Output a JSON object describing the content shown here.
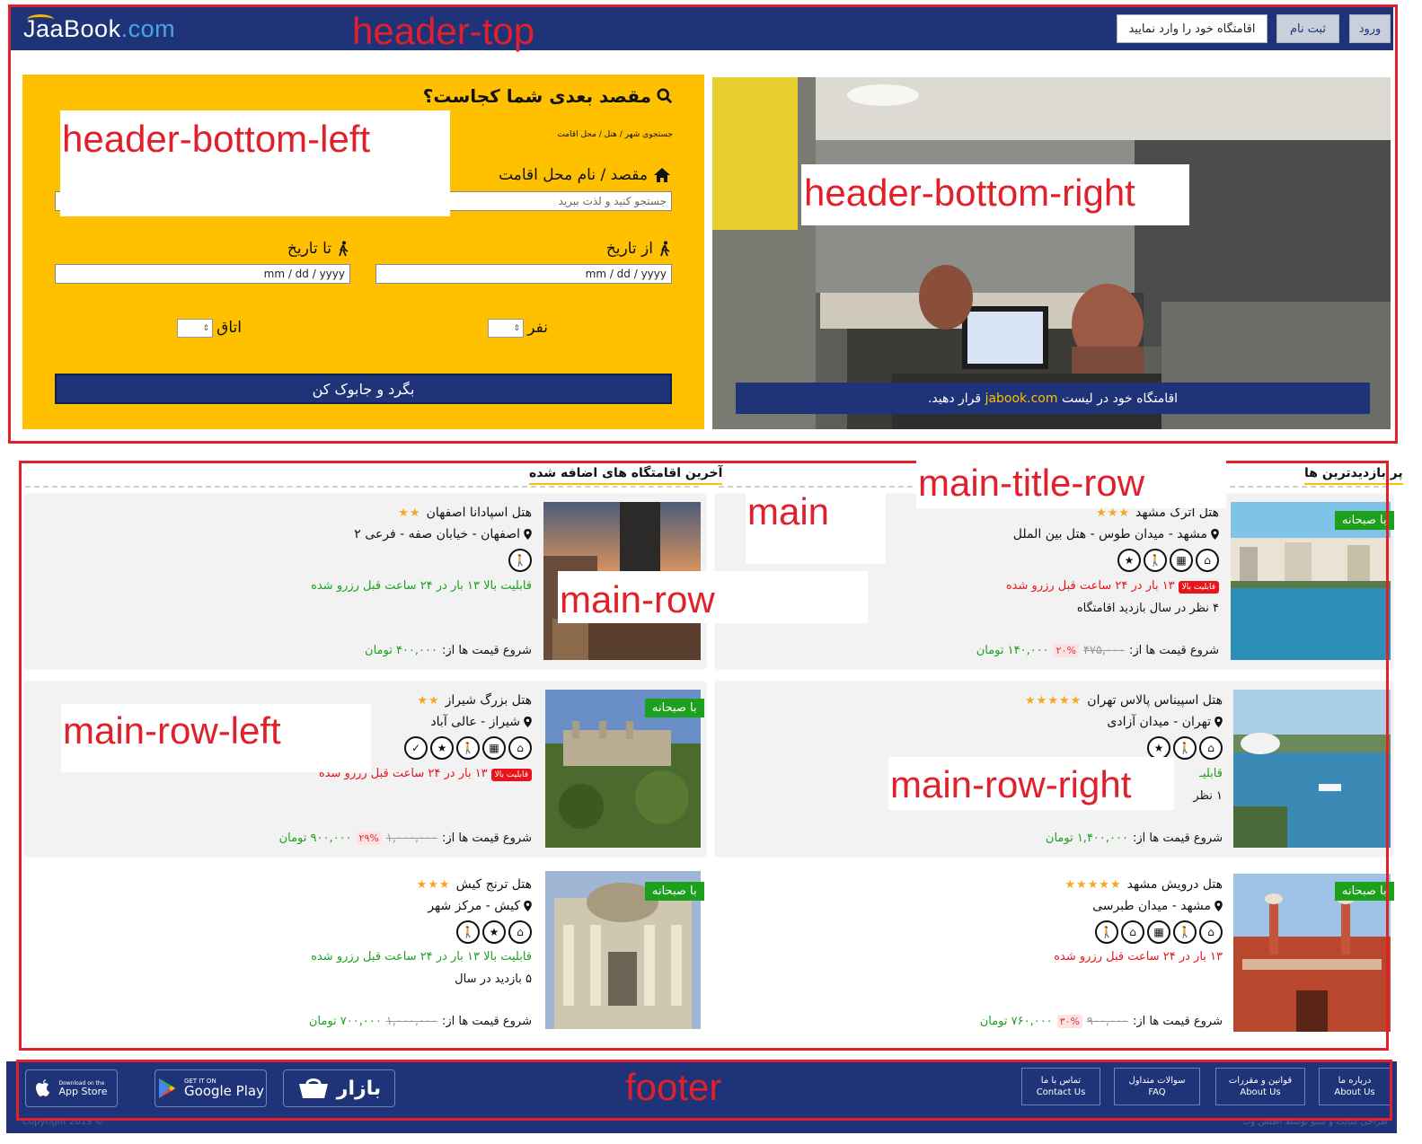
{
  "header": {
    "logo": {
      "main": "JaaBook",
      "suffix": ".com"
    },
    "buttons": {
      "login": "ورود",
      "register": "ثبت نام",
      "add_property": "اقامتگاه خود را وارد نمایید"
    }
  },
  "search": {
    "title": "مقصد بعدی شما کجاست؟",
    "breadcrumb": "جستجوی شهر / هتل / محل اقامت",
    "destination_label": "مقصد / نام محل اقامت",
    "destination_placeholder": "جستجو کنید و لذت ببرید",
    "from_label": "از تاریخ",
    "to_label": "تا تاریخ",
    "date_placeholder": "mm / dd / yyyy",
    "persons_label": "نفر",
    "rooms_label": "اتاق",
    "submit": "بگرد و جابوک کن"
  },
  "hero": {
    "caption_prefix": "اقامتگاه خود در لیست",
    "caption_link": "jabook.com",
    "caption_suffix": "قرار دهید."
  },
  "sections": {
    "latest_title": "آخرین اقامتگاه های اضافه شده",
    "popular_title": "پر بازدیدترین ها"
  },
  "cards": [
    {
      "name": "هتل اترک مشهد",
      "stars": "★★★",
      "location": "مشهد - میدان طوس - هتل بین الملل",
      "badge": "با صبحانه",
      "amenities": [
        "⌂",
        "▦",
        "🚶",
        "★"
      ],
      "hot": "قابلیت بالا",
      "note1": "۱۳ بار در ۲۴ ساعت قبل رزرو شده",
      "note2": "۴ نظر در سال بازدید اقامتگاه",
      "price_label": "شروع قیمت ها از:",
      "old": "۴۷۵,۰۰۰",
      "disc": "۲۰%",
      "new": "۱۴۰,۰۰۰ تومان"
    },
    {
      "name": "هتل اسپادانا اصفهان",
      "stars": "★★",
      "location": "اصفهان - خیابان صفه - فرعی ۲",
      "amenities": [
        "🚶"
      ],
      "note1": "قابلیت بالا ۱۳ بار در ۲۴ ساعت قبل رزرو شده",
      "price_label": "شروع قیمت ها از:",
      "new": "۴۰۰,۰۰۰ تومان"
    },
    {
      "name": "هتل اسپیناس پالاس تهران",
      "stars": "★★★★★",
      "location": "تهران - میدان آزادی",
      "amenities": [
        "⌂",
        "🚶",
        "★"
      ],
      "note1": "قابلیـ",
      "note2": "۱ نظر",
      "price_label": "شروع قیمت ها از:",
      "new": "۱,۴۰۰,۰۰۰ تومان"
    },
    {
      "name": "هتل بزرگ شیراز",
      "stars": "★★",
      "location": "شیراز - عالی آباد",
      "badge": "با صبحانه",
      "amenities": [
        "⌂",
        "▦",
        "🚶",
        "★",
        "✓"
      ],
      "hot": "قابلیت بالا",
      "note1": "۱۳ بار در ۲۴ ساعت قبل رزرو شده",
      "price_label": "شروع قیمت ها از:",
      "old": "۱,۰۰۰,۰۰۰",
      "disc": "۲۹%",
      "new": "۹۰۰,۰۰۰ تومان"
    },
    {
      "name": "هتل درویش مشهد",
      "stars": "★★★★★",
      "location": "مشهد - میدان طبرسی",
      "badge": "با صبحانه",
      "amenities": [
        "⌂",
        "🚶",
        "▦",
        "⌂",
        "🚶"
      ],
      "note1": "۱۳ بار در ۲۴ ساعت قبل رزرو شده",
      "price_label": "شروع قیمت ها از:",
      "old": "۹۰۰,۰۰۰",
      "disc": "۳۰%",
      "new": "۷۶۰,۰۰۰ تومان"
    },
    {
      "name": "هتل ترنج کیش",
      "stars": "★★★",
      "location": "کیش - مرکز شهر",
      "badge": "با صبحانه",
      "amenities": [
        "⌂",
        "★",
        "🚶"
      ],
      "note1": "قابلیت بالا ۱۳ بار در ۲۴ ساعت قبل رزرو شده",
      "note2": "۵ بازدید در سال",
      "price_label": "شروع قیمت ها از:",
      "old": "۱,۰۰۰,۰۰۰",
      "new": "۷۰۰,۰۰۰ تومان"
    }
  ],
  "footer": {
    "links": [
      {
        "fa": "درباره ما",
        "en": "About Us"
      },
      {
        "fa": "قوانین و مقررات",
        "en": "About Us"
      },
      {
        "fa": "سوالات متداول",
        "en": "FAQ"
      },
      {
        "fa": "تماس با ما",
        "en": "Contact Us"
      }
    ],
    "stores": {
      "bazaar": "بازار",
      "gplay_small": "GET IT ON",
      "gplay": "Google Play",
      "appstore_small": "Download on the",
      "appstore": "App Store"
    },
    "copyright": "Copyright 2019 ©",
    "designer": "طراحی سایت و سئو توسط اطلس وب"
  },
  "annotations": {
    "header_top": "header-top",
    "header_bottom_left": "header-bottom-left",
    "header_bottom_right": "header-bottom-right",
    "main": "main",
    "main_title_row": "main-title-row",
    "main_row": "main-row",
    "main_row_left": "main-row-left",
    "main_row_right": "main-row-right",
    "footer": "footer"
  },
  "colors": {
    "navy": "#1f3478",
    "yellow": "#ffc000",
    "green": "#1da01d",
    "red": "#e8141a",
    "annotation": "#e0202a"
  }
}
